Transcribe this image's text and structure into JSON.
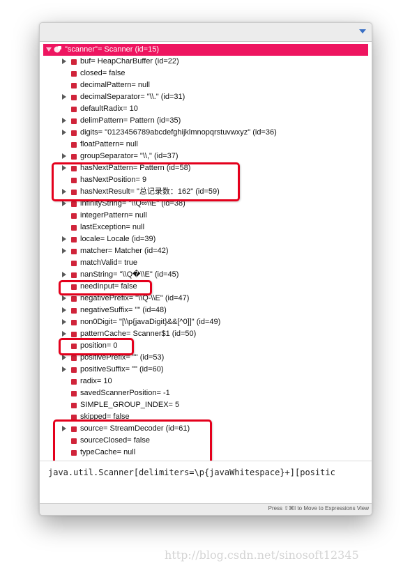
{
  "panel": {
    "menu_icon": "chevron-down-icon",
    "selected_color": "#ee1560",
    "highlight_color": "#e4001c",
    "root": {
      "label": "\"scanner\"= Scanner  (id=15)",
      "expanded": true
    },
    "variables": [
      {
        "label": "buf= HeapCharBuffer  (id=22)",
        "expandable": true
      },
      {
        "label": "closed= false",
        "expandable": false
      },
      {
        "label": "decimalPattern= null",
        "expandable": false
      },
      {
        "label": "decimalSeparator= \"\\\\.\" (id=31)",
        "expandable": true
      },
      {
        "label": "defaultRadix= 10",
        "expandable": false
      },
      {
        "label": "delimPattern= Pattern  (id=35)",
        "expandable": true
      },
      {
        "label": "digits= \"0123456789abcdefghijklmnopqrstuvwxyz\" (id=36)",
        "expandable": true
      },
      {
        "label": "floatPattern= null",
        "expandable": false
      },
      {
        "label": "groupSeparator= \"\\\\,\" (id=37)",
        "expandable": true
      },
      {
        "label": "hasNextPattern= Pattern  (id=58)",
        "expandable": true
      },
      {
        "label": "hasNextPosition= 9",
        "expandable": false
      },
      {
        "label": "hasNextResult= \"总记录数：162\" (id=59)",
        "expandable": true
      },
      {
        "label": "infinityString= \"\\\\Q∞\\\\E\" (id=38)",
        "expandable": true
      },
      {
        "label": "integerPattern= null",
        "expandable": false
      },
      {
        "label": "lastException= null",
        "expandable": false
      },
      {
        "label": "locale= Locale  (id=39)",
        "expandable": true
      },
      {
        "label": "matcher= Matcher  (id=42)",
        "expandable": true
      },
      {
        "label": "matchValid= true",
        "expandable": false
      },
      {
        "label": "nanString= \"\\\\Q�\\\\E\" (id=45)",
        "expandable": true
      },
      {
        "label": "needInput= false",
        "expandable": false
      },
      {
        "label": "negativePrefix= \"\\\\Q-\\\\E\" (id=47)",
        "expandable": true
      },
      {
        "label": "negativeSuffix= \"\" (id=48)",
        "expandable": true
      },
      {
        "label": "non0Digit= \"[\\\\p{javaDigit}&&[^0]]\" (id=49)",
        "expandable": true
      },
      {
        "label": "patternCache= Scanner$1  (id=50)",
        "expandable": true
      },
      {
        "label": "position= 0",
        "expandable": false
      },
      {
        "label": "positivePrefix= \"\" (id=53)",
        "expandable": true
      },
      {
        "label": "positiveSuffix= \"\" (id=60)",
        "expandable": true
      },
      {
        "label": "radix= 10",
        "expandable": false
      },
      {
        "label": "savedScannerPosition= -1",
        "expandable": false
      },
      {
        "label": "SIMPLE_GROUP_INDEX= 5",
        "expandable": false
      },
      {
        "label": "skipped= false",
        "expandable": false
      },
      {
        "label": "source= StreamDecoder  (id=61)",
        "expandable": true
      },
      {
        "label": "sourceClosed= false",
        "expandable": false
      },
      {
        "label": "typeCache= null",
        "expandable": false
      }
    ],
    "detail_text": "java.util.Scanner[delimiters=\\p{javaWhitespace}+][positic",
    "status_text": "Press ⇧⌘I to Move to Expressions View"
  },
  "watermark": "http://blog.csdn.net/sinosoft12345"
}
